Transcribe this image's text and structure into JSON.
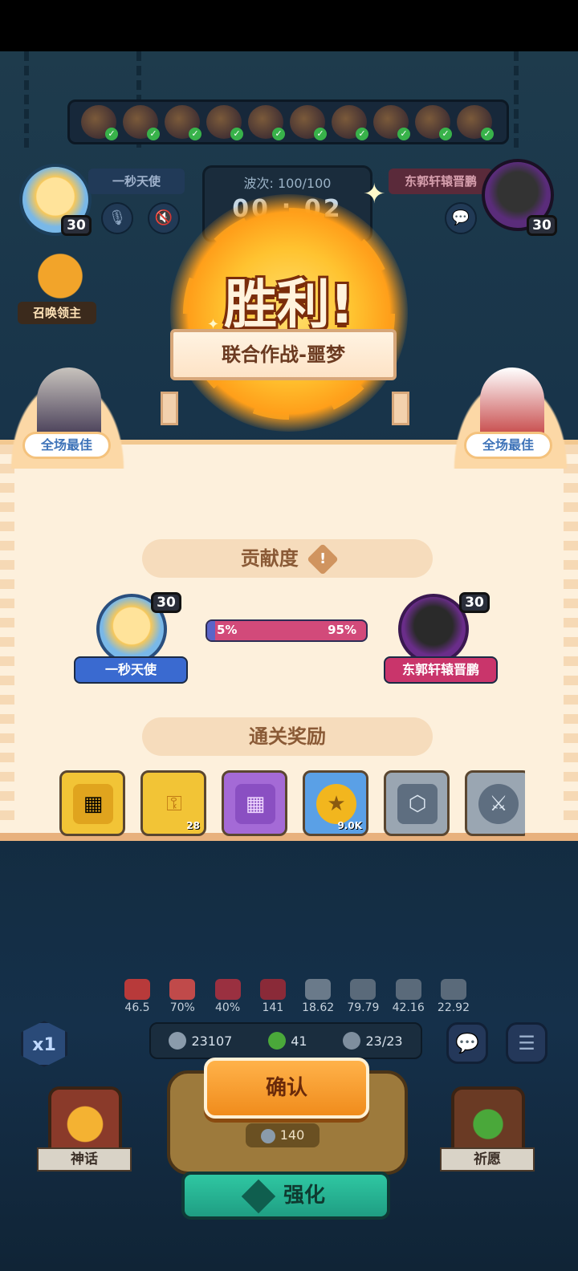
{
  "header": {
    "wave_label": "波次: 100/100",
    "timer": "00 : 02",
    "player_left": {
      "name": "一秒天使",
      "level": "30"
    },
    "player_right": {
      "name": "东郭轩辕晋鹏",
      "level": "30"
    },
    "summon_lord_label": "召唤领主",
    "hero_strip_count": 10
  },
  "victory": {
    "title": "胜利!",
    "mode": "联合作战-噩梦"
  },
  "panel": {
    "mvp_left": "全场最佳",
    "mvp_right": "全场最佳",
    "contribution_title": "贡献度",
    "contribution_info_icon": "!",
    "player_left": {
      "name": "一秒天使",
      "level": "30"
    },
    "player_right": {
      "name": "东郭轩辕晋鹏",
      "level": "30"
    },
    "contribution": {
      "left_pct": 5,
      "right_pct": 95,
      "left_label": "5%",
      "right_label": "95%"
    },
    "rewards_title": "通关奖励",
    "rewards": [
      {
        "icon": "gold-chest-icon",
        "qty": ""
      },
      {
        "icon": "key-icon",
        "qty": "28"
      },
      {
        "icon": "purple-chest-icon",
        "qty": ""
      },
      {
        "icon": "coin-icon",
        "qty": "9.0K"
      },
      {
        "icon": "emblem-icon",
        "qty": ""
      },
      {
        "icon": "trident-emblem-icon",
        "qty": ""
      }
    ]
  },
  "hud": {
    "stats": [
      "46.5",
      "70%",
      "40%",
      "141",
      "18.62",
      "79.79",
      "42.16",
      "22.92"
    ],
    "resources": {
      "silver": "23107",
      "clover": "41",
      "units": "23/23"
    },
    "speed": "x1",
    "confirm_label": "确认",
    "cost": "140",
    "left_card_label": "神话",
    "right_card_label": "祈愿",
    "upgrade_label": "强化"
  },
  "colors": {
    "panel_bg": "#fdf0dc",
    "bar_left": "#5a64c8",
    "bar_right": "#d24a7a",
    "confirm": "#f08c1c",
    "upgrade": "#1f9e83"
  }
}
